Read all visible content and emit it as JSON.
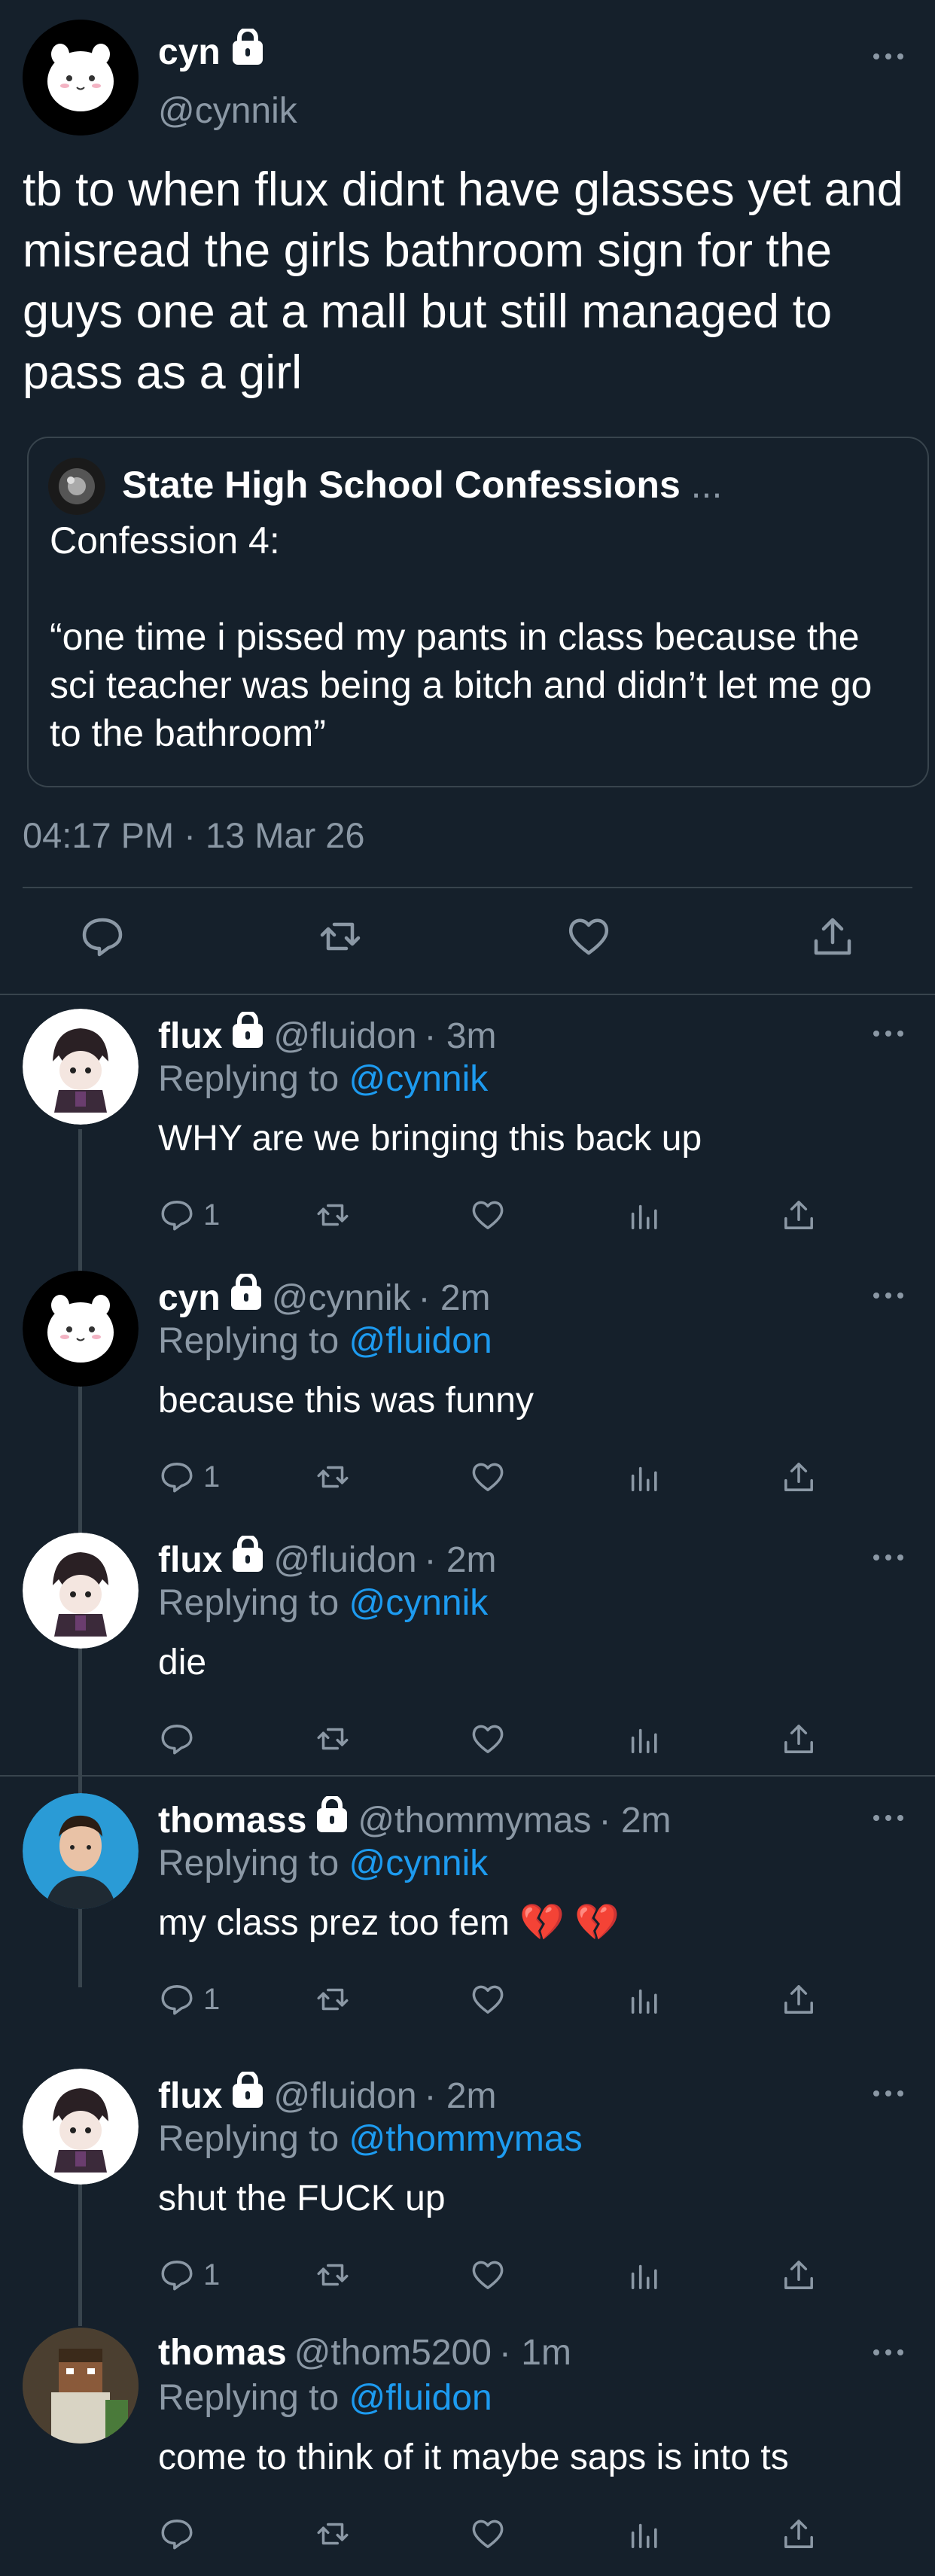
{
  "main_tweet": {
    "name": "cyn",
    "handle": "@cynnik",
    "text": "tb to when flux didnt have glasses yet and misread the girls bathroom sign for the guys one at a mall but still managed to pass as a girl",
    "quote": {
      "name": "State High School Confessions",
      "ellipsis": "...",
      "text": "Confession 4:\n\n“one time i pissed my pants in class because the sci teacher was being a bitch and didn’t let me go to the bathroom”"
    },
    "timestamp": "04:17 PM · 13 Mar 26",
    "icons": [
      "reply-icon",
      "retweet-icon",
      "like-icon",
      "share-icon"
    ]
  },
  "replies": [
    {
      "name": "flux",
      "locked": true,
      "handle": "@fluidon",
      "time": "· 3m",
      "replying_prefix": "Replying to",
      "replying_to": "@cynnik",
      "text": "WHY are we bringing this back up",
      "reply_count": "1"
    },
    {
      "name": "cyn",
      "locked": true,
      "handle": "@cynnik",
      "time": "· 2m",
      "replying_prefix": "Replying to",
      "replying_to": "@fluidon",
      "text": "because this was funny",
      "reply_count": "1"
    },
    {
      "name": "flux",
      "locked": true,
      "handle": "@fluidon",
      "time": "· 2m",
      "replying_prefix": "Replying to",
      "replying_to": "@cynnik",
      "text": "die",
      "reply_count": ""
    },
    {
      "name": "thomass",
      "locked": true,
      "handle": "@thommymas",
      "time": "· 2m",
      "replying_prefix": "Replying to",
      "replying_to": "@cynnik",
      "text": "my class prez too fem 💔 💔",
      "reply_count": "1"
    },
    {
      "name": "flux",
      "locked": true,
      "handle": "@fluidon",
      "time": "· 2m",
      "replying_prefix": "Replying to",
      "replying_to": "@thommymas",
      "text": "shut the FUCK up",
      "reply_count": "1"
    },
    {
      "name": "thomas",
      "locked": false,
      "handle": "@thom5200",
      "time": "· 1m",
      "replying_prefix": "Replying to",
      "replying_to": "@fluidon",
      "text": "come to think of it maybe saps is into ts",
      "reply_count": ""
    }
  ],
  "colors": {
    "background": "#15202b",
    "muted": "#8b98a5",
    "link": "#1d9bf0",
    "divider": "#38444d"
  }
}
